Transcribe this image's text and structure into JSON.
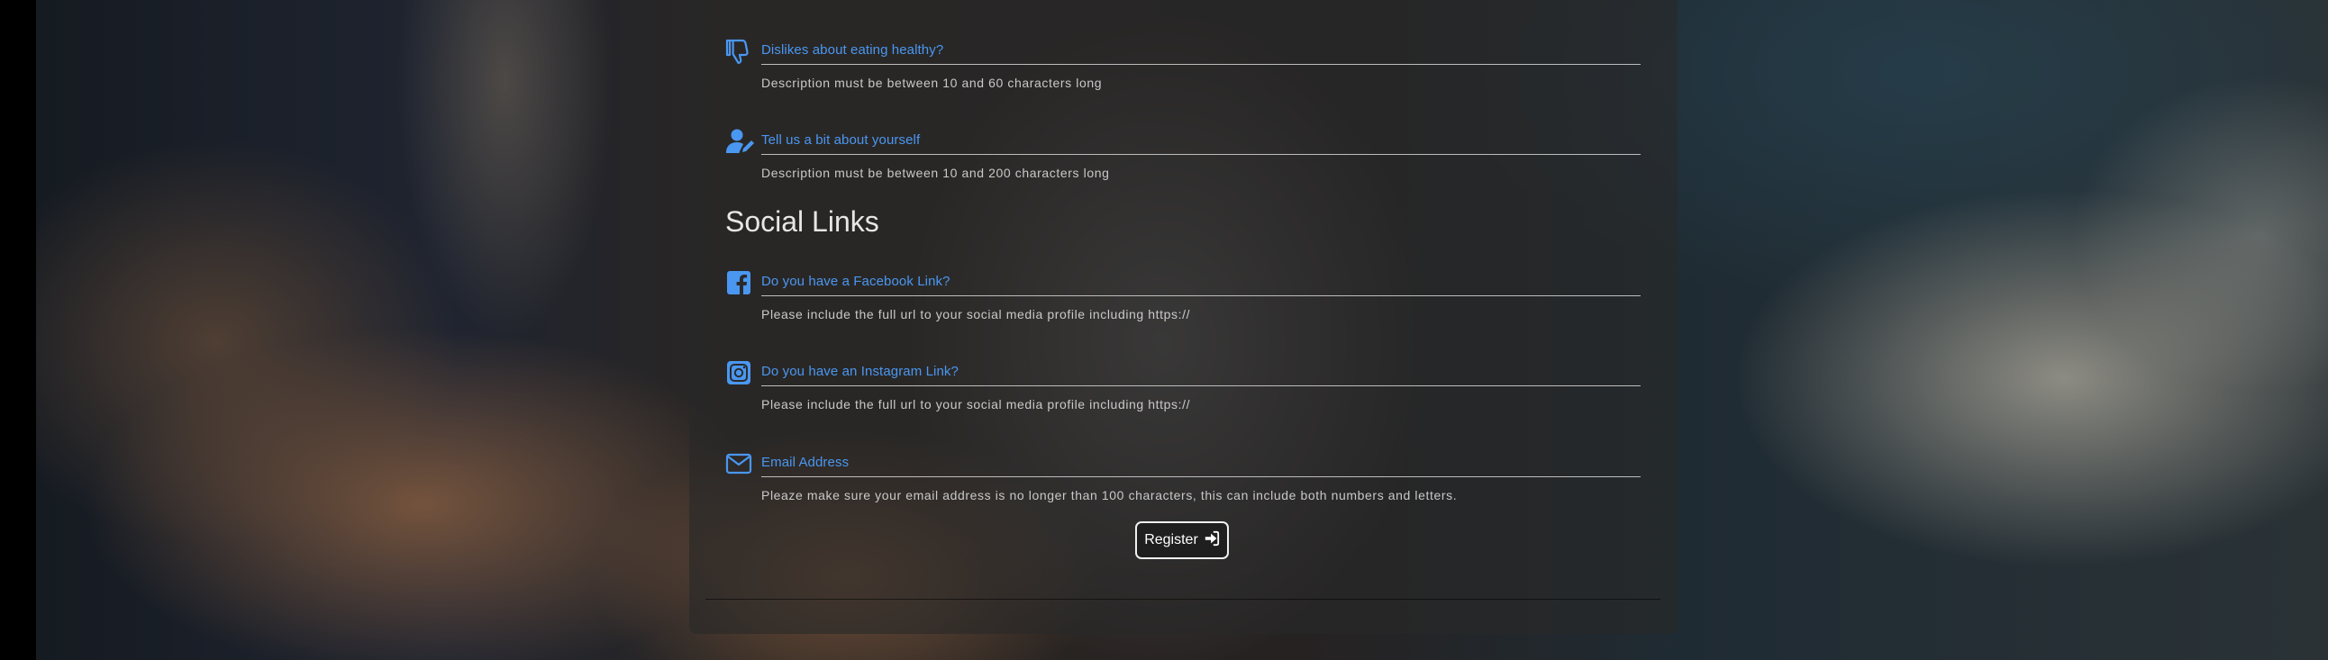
{
  "fields": [
    {
      "label": "Dislikes about eating healthy?",
      "help": "Description must be between 10 and 60 characters long",
      "icon": "thumbs-down-icon"
    },
    {
      "label": "Tell us a bit about yourself",
      "help": "Description must be between 10 and 200 characters long",
      "icon": "user-edit-icon"
    }
  ],
  "social": {
    "title": "Social Links",
    "fields": [
      {
        "label": "Do you have a Facebook Link?",
        "help": "Please include the full url to your social media profile including https://",
        "icon": "facebook-icon"
      },
      {
        "label": "Do you have an Instagram Link?",
        "help": "Please include the full url to your social media profile including https://",
        "icon": "instagram-icon"
      },
      {
        "label": "Email Address",
        "help": "Pleaze make sure your email address is no longer than 100 characters, this can include both numbers and letters.",
        "icon": "envelope-icon"
      }
    ]
  },
  "register": {
    "label": "Register",
    "icon": "sign-in-icon"
  },
  "colors": {
    "label_accent": "#4a97f1",
    "panel": "#282828",
    "help_text": "#c9c9c9"
  }
}
